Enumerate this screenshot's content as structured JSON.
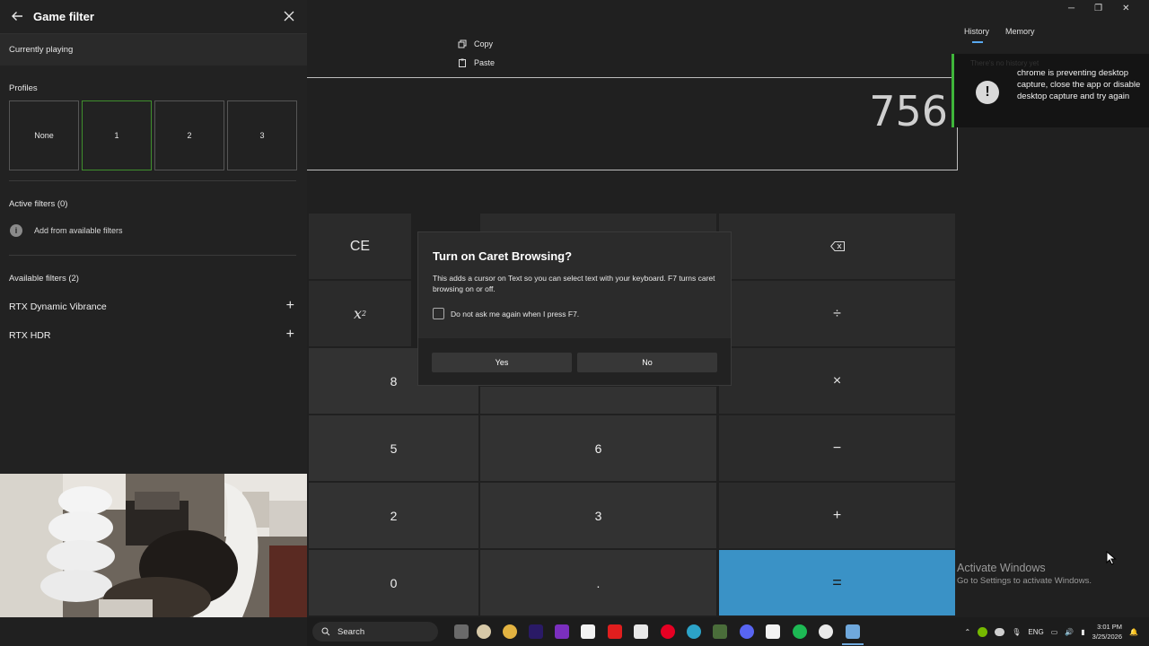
{
  "game_filter": {
    "title": "Game filter",
    "currently_playing": "Currently playing",
    "profiles_label": "Profiles",
    "profiles": [
      "None",
      "1",
      "2",
      "3"
    ],
    "active_filters_label": "Active filters (0)",
    "add_filter_label": "Add from available filters",
    "available_filters_label": "Available filters (2)",
    "available_filters": [
      "RTX Dynamic Vibrance",
      "RTX HDR"
    ]
  },
  "calculator": {
    "display_value": "756",
    "tabs": [
      "History",
      "Memory"
    ],
    "context_menu": [
      "Copy",
      "Paste"
    ],
    "keys": {
      "ce": "CE",
      "x_squared": "x",
      "x_squared_exp": "2",
      "eight": "8",
      "five": "5",
      "six": "6",
      "two": "2",
      "three": "3",
      "zero": "0",
      "decimal": ".",
      "divide": "÷",
      "multiply": "×",
      "minus": "−",
      "plus": "+",
      "equals": "="
    },
    "history_placeholder": "There's no history yet"
  },
  "notification": {
    "text": "chrome is preventing desktop capture, close the app or disable desktop capture and try again"
  },
  "dialog": {
    "title": "Turn on Caret Browsing?",
    "body": "This adds a cursor on Text so you can select text with your keyboard. F7 turns caret browsing on or off.",
    "checkbox_label": "Do not ask me again when I press F7.",
    "yes": "Yes",
    "no": "No"
  },
  "watermark": {
    "title": "Activate Windows",
    "subtitle": "Go to Settings to activate Windows."
  },
  "taskbar": {
    "search_label": "Search",
    "language": "ENG",
    "time": "3:01 PM",
    "date": "3/25/2026"
  },
  "colors": {
    "accent_green": "#3f8f2d",
    "equals_blue": "#3a92c6",
    "notification_bar": "#3fb63a"
  }
}
